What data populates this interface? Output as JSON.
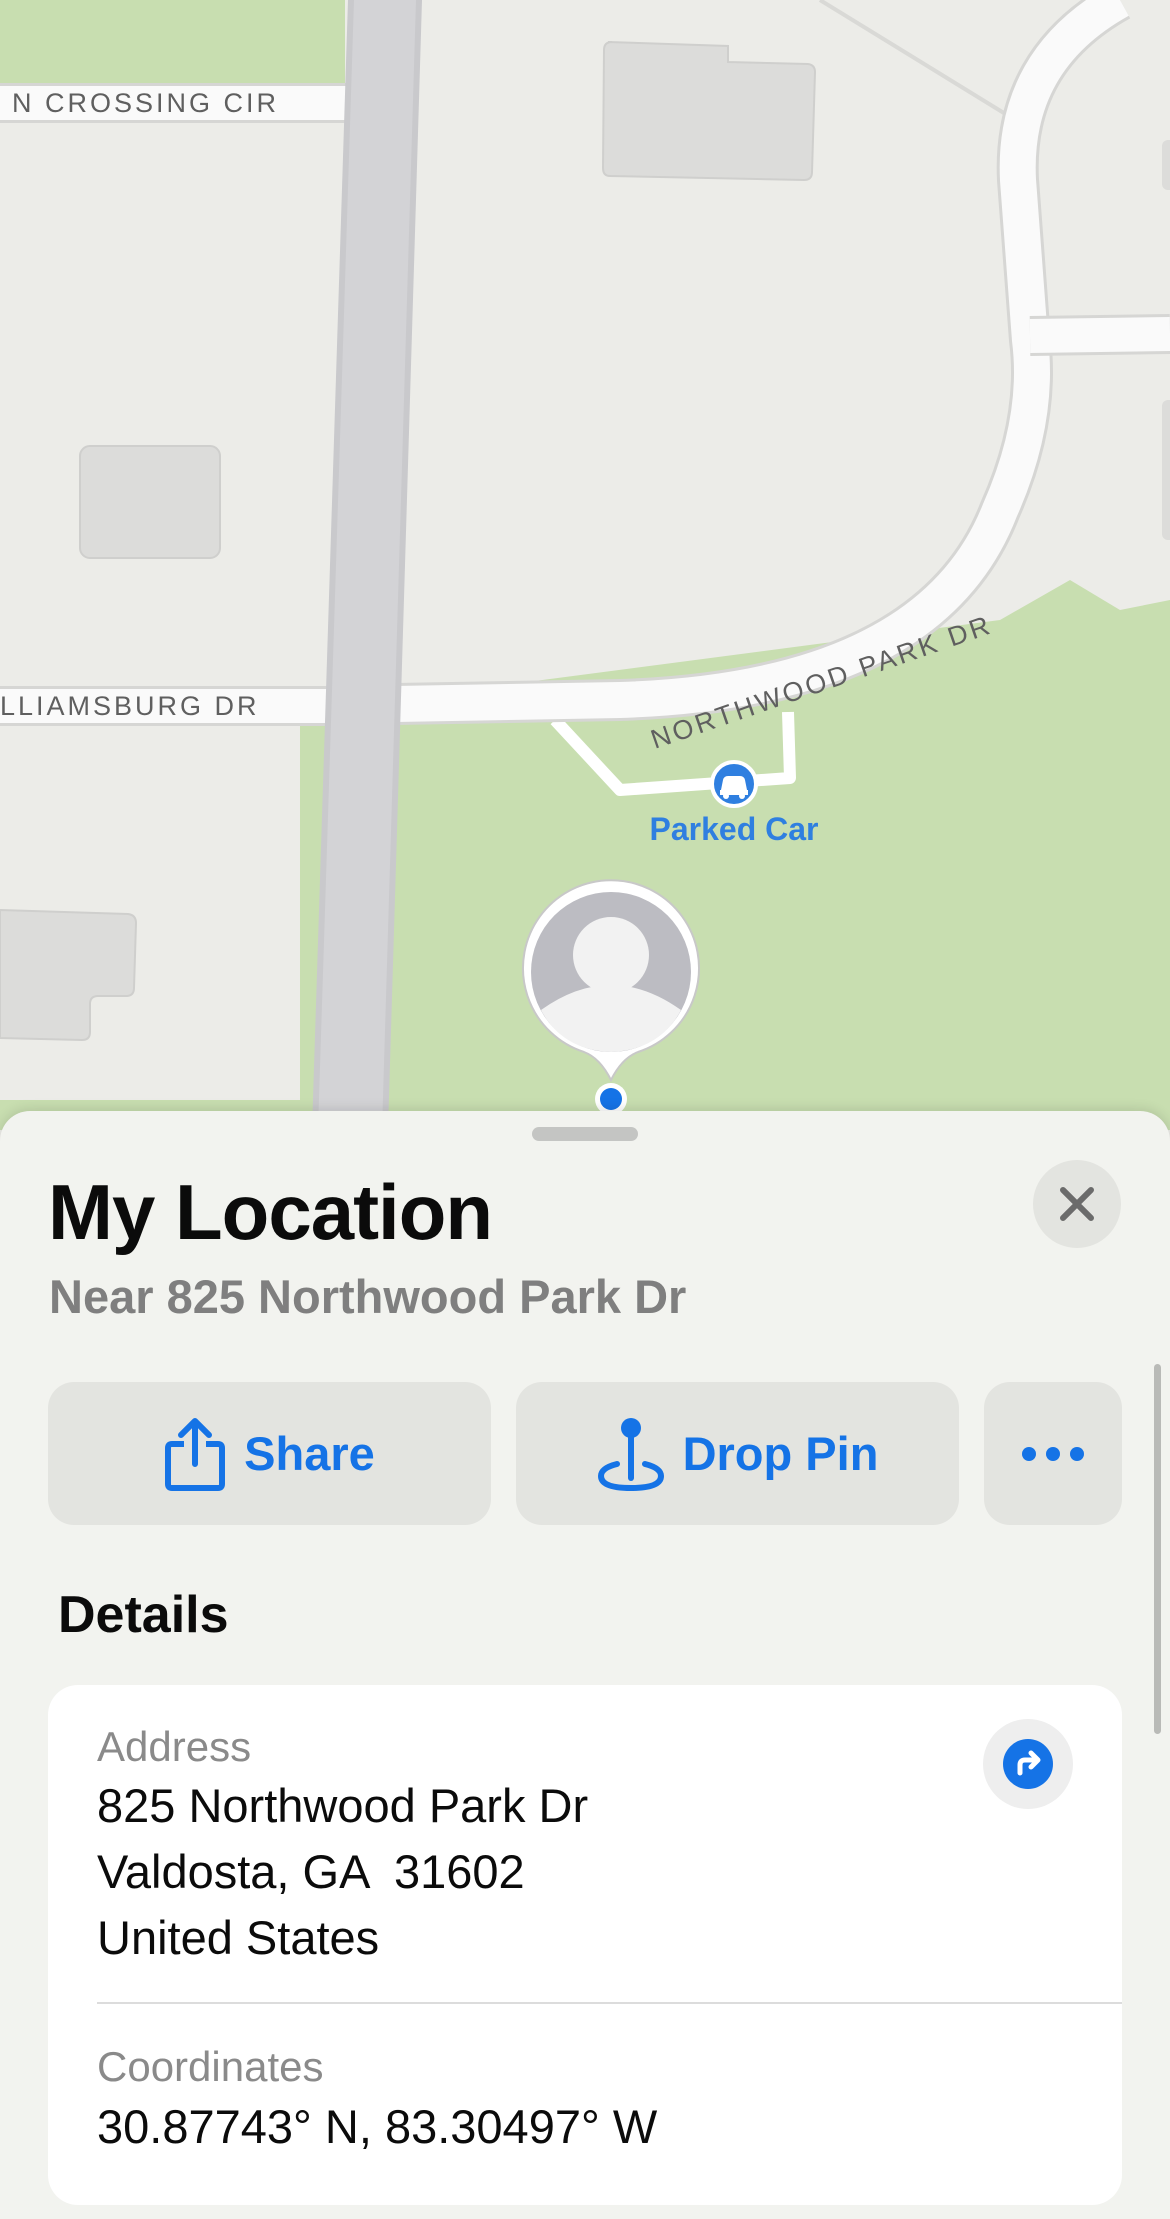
{
  "map": {
    "streets": {
      "crossing": "N CROSSING CIR",
      "williamsburg": "LLIAMSBURG DR",
      "northwood": "NORTHWOOD PARK DR"
    },
    "poi": {
      "label": "Parked Car",
      "icon": "car-icon",
      "color": "#2f7fe0"
    },
    "user_pin": {
      "icon": "person-avatar-icon",
      "dot_color": "#1573e6"
    }
  },
  "sheet": {
    "title": "My Location",
    "subtitle": "Near 825 Northwood Park Dr",
    "close_icon": "close-icon",
    "actions": {
      "share": {
        "label": "Share",
        "icon": "share-icon"
      },
      "drop_pin": {
        "label": "Drop Pin",
        "icon": "pin-icon"
      },
      "more": {
        "icon": "ellipsis-icon"
      }
    },
    "accent_color": "#1573e6",
    "details_heading": "Details",
    "address": {
      "label": "Address",
      "line1": "825 Northwood Park Dr",
      "line2": "Valdosta, GA  31602",
      "line3": "United States",
      "directions_icon": "directions-icon"
    },
    "coordinates": {
      "label": "Coordinates",
      "value": "30.87743° N, 83.30497° W"
    }
  }
}
